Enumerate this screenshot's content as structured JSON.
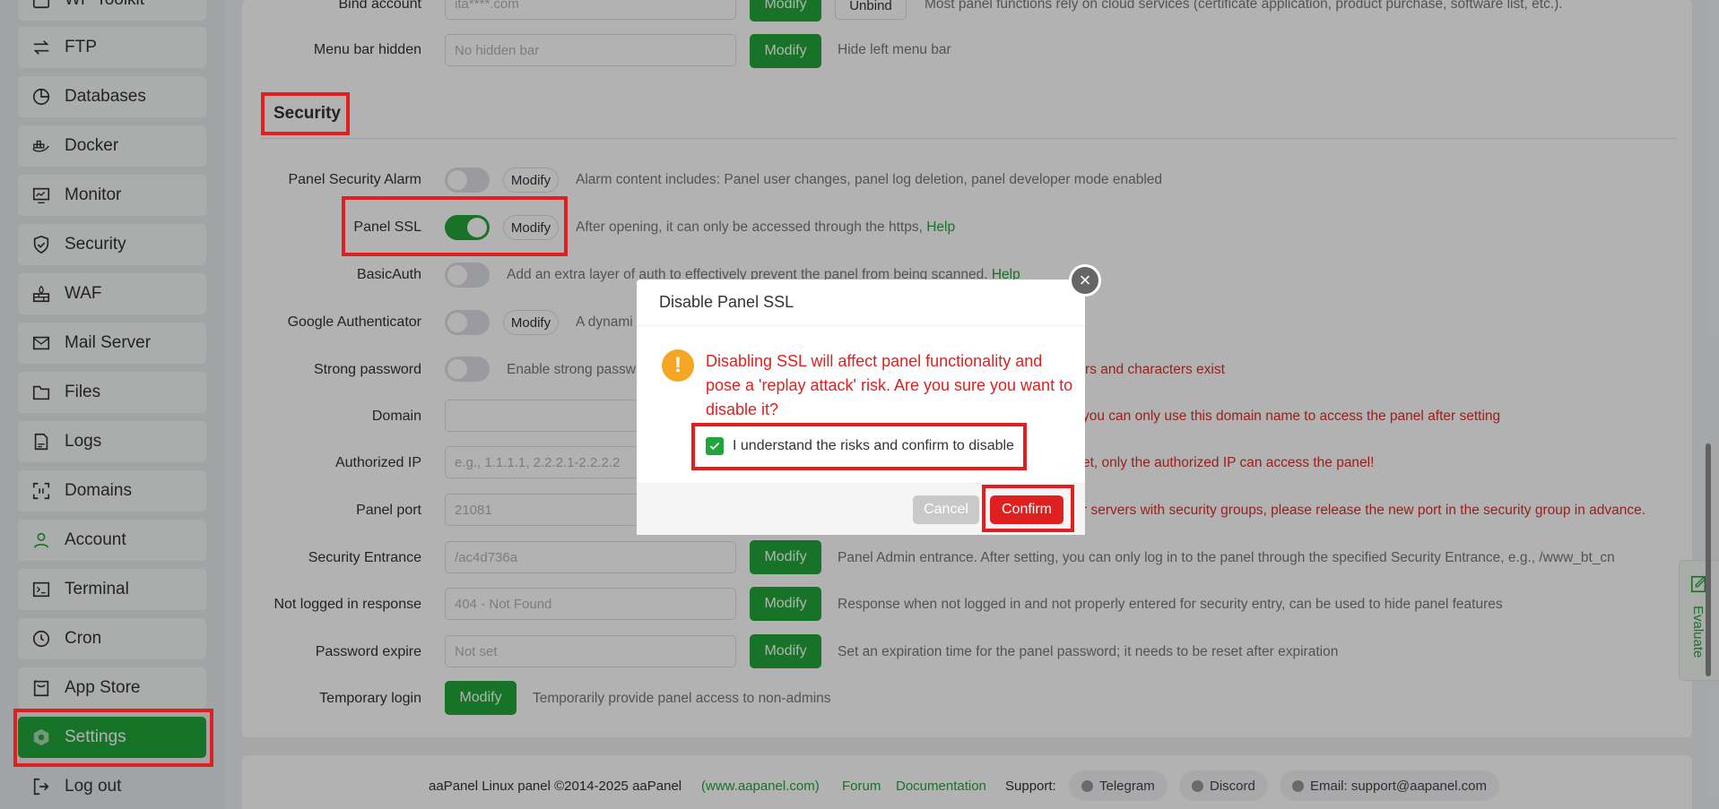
{
  "sidebar": {
    "items": [
      {
        "label": "WP Toolkit",
        "icon": "wordpress-icon"
      },
      {
        "label": "FTP",
        "icon": "arrows-icon"
      },
      {
        "label": "Databases",
        "icon": "database-icon"
      },
      {
        "label": "Docker",
        "icon": "docker-icon"
      },
      {
        "label": "Monitor",
        "icon": "monitor-icon"
      },
      {
        "label": "Security",
        "icon": "shield-icon"
      },
      {
        "label": "WAF",
        "icon": "firewall-icon"
      },
      {
        "label": "Mail Server",
        "icon": "mail-icon"
      },
      {
        "label": "Files",
        "icon": "folder-icon"
      },
      {
        "label": "Logs",
        "icon": "log-icon"
      },
      {
        "label": "Domains",
        "icon": "domain-icon"
      },
      {
        "label": "Account",
        "icon": "user-icon"
      },
      {
        "label": "Terminal",
        "icon": "terminal-icon"
      },
      {
        "label": "Cron",
        "icon": "clock-icon"
      },
      {
        "label": "App Store",
        "icon": "store-icon"
      },
      {
        "label": "Settings",
        "icon": "gear-icon"
      },
      {
        "label": "Log out",
        "icon": "logout-icon"
      }
    ]
  },
  "bind_account": {
    "label": "Bind account",
    "value": "ita****.com",
    "modify": "Modify",
    "unbind": "Unbind",
    "desc": "Most panel functions rely on cloud services (certificate application, product purchase, software list, etc.)."
  },
  "menu_bar": {
    "label": "Menu bar hidden",
    "placeholder": "No hidden bar",
    "modify": "Modify",
    "desc": "Hide left menu bar"
  },
  "security": {
    "title": "Security",
    "alarm": {
      "label": "Panel Security Alarm",
      "modify": "Modify",
      "desc": "Alarm content includes: Panel user changes, panel log deletion, panel developer mode enabled",
      "enabled": false
    },
    "ssl": {
      "label": "Panel SSL",
      "modify": "Modify",
      "desc": "After opening, it can only be accessed through the https,",
      "help": "Help",
      "enabled": true
    },
    "basicauth": {
      "label": "BasicAuth",
      "desc": "Add an extra layer of auth to effectively prevent the panel from being scanned.",
      "help": "Help",
      "enabled": false
    },
    "google_auth": {
      "label": "Google Authenticator",
      "modify": "Modify",
      "desc": "A dynami",
      "enabled": false
    },
    "strong_pw": {
      "label": "Strong password",
      "desc": "Enable strong passw",
      "desc_tail": "rs and characters exist",
      "enabled": false
    },
    "domain": {
      "label": "Domain",
      "desc_tail": "you can only use this domain name to access the panel after setting"
    },
    "authorized_ip": {
      "label": "Authorized IP",
      "placeholder": "e.g., 1.1.1.1, 2.2.2.1-2.2.2.2",
      "desc_tail": "et, only the authorized IP can access the panel!"
    },
    "panel_port": {
      "label": "Panel port",
      "value": "21081",
      "desc_tail": "r servers with security groups, please release the new port in the security group in advance."
    },
    "entrance": {
      "label": "Security Entrance",
      "value": "/ac4d736a",
      "modify": "Modify",
      "desc": "Panel Admin entrance. After setting, you can only log in to the panel through the specified Security Entrance, e.g., /www_bt_cn"
    },
    "not_logged": {
      "label": "Not logged in response",
      "value": "404 - Not Found",
      "modify": "Modify",
      "desc": "Response when not logged in and not properly entered for security entry, can be used to hide panel features"
    },
    "pw_expire": {
      "label": "Password expire",
      "value": "Not set",
      "modify": "Modify",
      "desc": "Set an expiration time for the panel password; it needs to be reset after expiration"
    },
    "temp_login": {
      "label": "Temporary login",
      "modify": "Modify",
      "desc": "Temporarily provide panel access to non-admins"
    }
  },
  "dialog": {
    "title": "Disable Panel SSL",
    "close": "×",
    "message": "Disabling SSL will affect panel functionality and pose a 'replay attack' risk. Are you sure you want to disable it?",
    "checkbox_label": "I understand the risks and confirm to disable",
    "checked": true,
    "cancel": "Cancel",
    "confirm": "Confirm"
  },
  "evaluate": {
    "label": "Evaluate"
  },
  "footer": {
    "copyright": "aaPanel Linux panel ©2014-2025 aaPanel",
    "site": "(www.aapanel.com)",
    "forum": "Forum",
    "docs": "Documentation",
    "support": "Support:",
    "telegram": "Telegram",
    "discord": "Discord",
    "email": "Email: support@aapanel.com"
  },
  "colors": {
    "accent": "#20a53a",
    "danger": "#e02020",
    "warning": "#f5a623"
  }
}
